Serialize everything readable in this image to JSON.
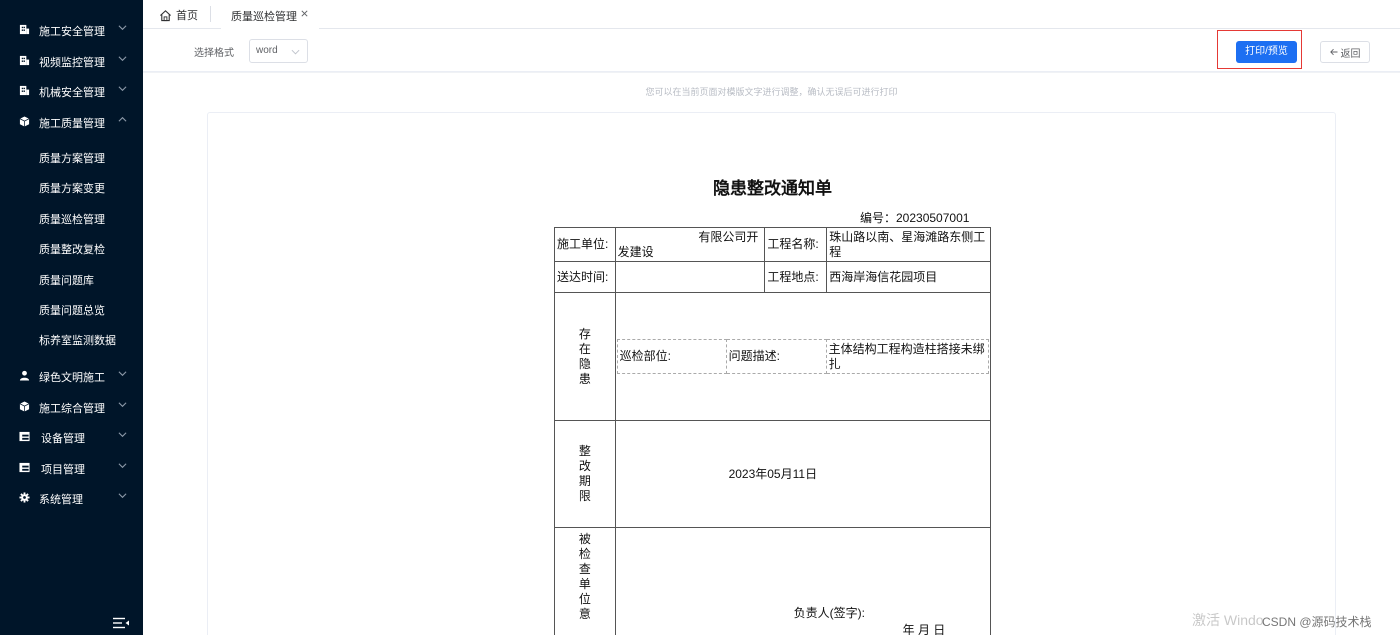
{
  "sidebar": {
    "menu": [
      {
        "label": "施工安全管理",
        "icon": "building-icon",
        "expanded": false
      },
      {
        "label": "视频监控管理",
        "icon": "building-icon",
        "expanded": false
      },
      {
        "label": "机械安全管理",
        "icon": "building-icon",
        "expanded": false
      },
      {
        "label": "施工质量管理",
        "icon": "cube-icon",
        "expanded": true
      },
      {
        "label": "绿色文明施工",
        "icon": "user-icon",
        "expanded": false
      },
      {
        "label": "施工综合管理",
        "icon": "cube-icon",
        "expanded": false
      },
      {
        "label": "设备管理",
        "icon": "table-icon",
        "expanded": false
      },
      {
        "label": "项目管理",
        "icon": "table-icon",
        "expanded": false
      },
      {
        "label": "系统管理",
        "icon": "gear-icon",
        "expanded": false
      }
    ],
    "submenu": [
      "质量方案管理",
      "质量方案变更",
      "质量巡检管理",
      "质量整改复检",
      "质量问题库",
      "质量问题总览",
      "标养室监测数据"
    ],
    "collapse_icon": "menu-fold-icon"
  },
  "tabs": {
    "home": "首页",
    "active": "质量巡检管理"
  },
  "toolbar": {
    "format_label": "选择格式",
    "format_value": "word",
    "print_label": "打印/预览",
    "back_label": "返回",
    "primary_color": "#1d6ff2"
  },
  "hint": "您可以在当前页面对模版文字进行调整，确认无误后可进行打印",
  "doc": {
    "title": "隐患整改通知单",
    "number": "编号：20230507001",
    "unit_label": "施工单位:",
    "unit_value_line1": "有限公司开",
    "unit_value_line2": "发建设",
    "project_name_label": "工程名称:",
    "project_name_value": "珠山路以南、星海滩路东侧工程",
    "send_time_label": "送达时间:",
    "send_time_value": "",
    "project_site_label": "工程地点:",
    "project_site_value": "西海岸海信花园项目",
    "hazard_label": [
      "存",
      "在",
      "隐",
      "患"
    ],
    "inspect_part_label": "巡检部位:",
    "inspect_part_value": "",
    "issue_desc_label": "问题描述:",
    "issue_desc_value": "主体结构工程构造柱搭接未绑扎",
    "deadline_label": [
      "整",
      "改",
      "期",
      "限"
    ],
    "deadline_value": "2023年05月11日",
    "inspected_label": [
      "被",
      "检",
      "查",
      "单",
      "位",
      "意"
    ],
    "signer_label": "负责人(签字):",
    "date_line": "年      月      日"
  },
  "watermark": {
    "activate": "激活 Windo",
    "csdn": "CSDN @源码技术栈"
  }
}
